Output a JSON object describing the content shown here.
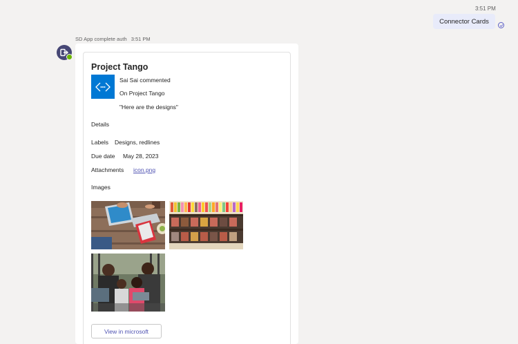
{
  "sent_message": {
    "time": "3:51 PM",
    "text": "Connector Cards"
  },
  "received": {
    "sender": "SD App complete auth",
    "time": "3:51 PM"
  },
  "card": {
    "title": "Project Tango",
    "activity_title": "Sai Sai commented",
    "activity_subtitle": "On Project Tango",
    "activity_text": "\"Here are the designs\"",
    "details_heading": "Details",
    "facts": [
      {
        "label": "Labels",
        "value": "Designs, redlines"
      },
      {
        "label": "Due date",
        "value": "May 28, 2023"
      },
      {
        "label": "Attachments",
        "value": "icon.png"
      }
    ],
    "images_heading": "Images",
    "action_label": "View in microsoft"
  },
  "colors": {
    "accent": "#5b5fc7",
    "bubble": "#e8ebfa",
    "logo_bg": "#0078d4",
    "link": "#4f52b2"
  },
  "icons": {
    "avatar": "app-exit-icon",
    "status": "sent-check-icon",
    "logo": "code-diamond-icon"
  }
}
